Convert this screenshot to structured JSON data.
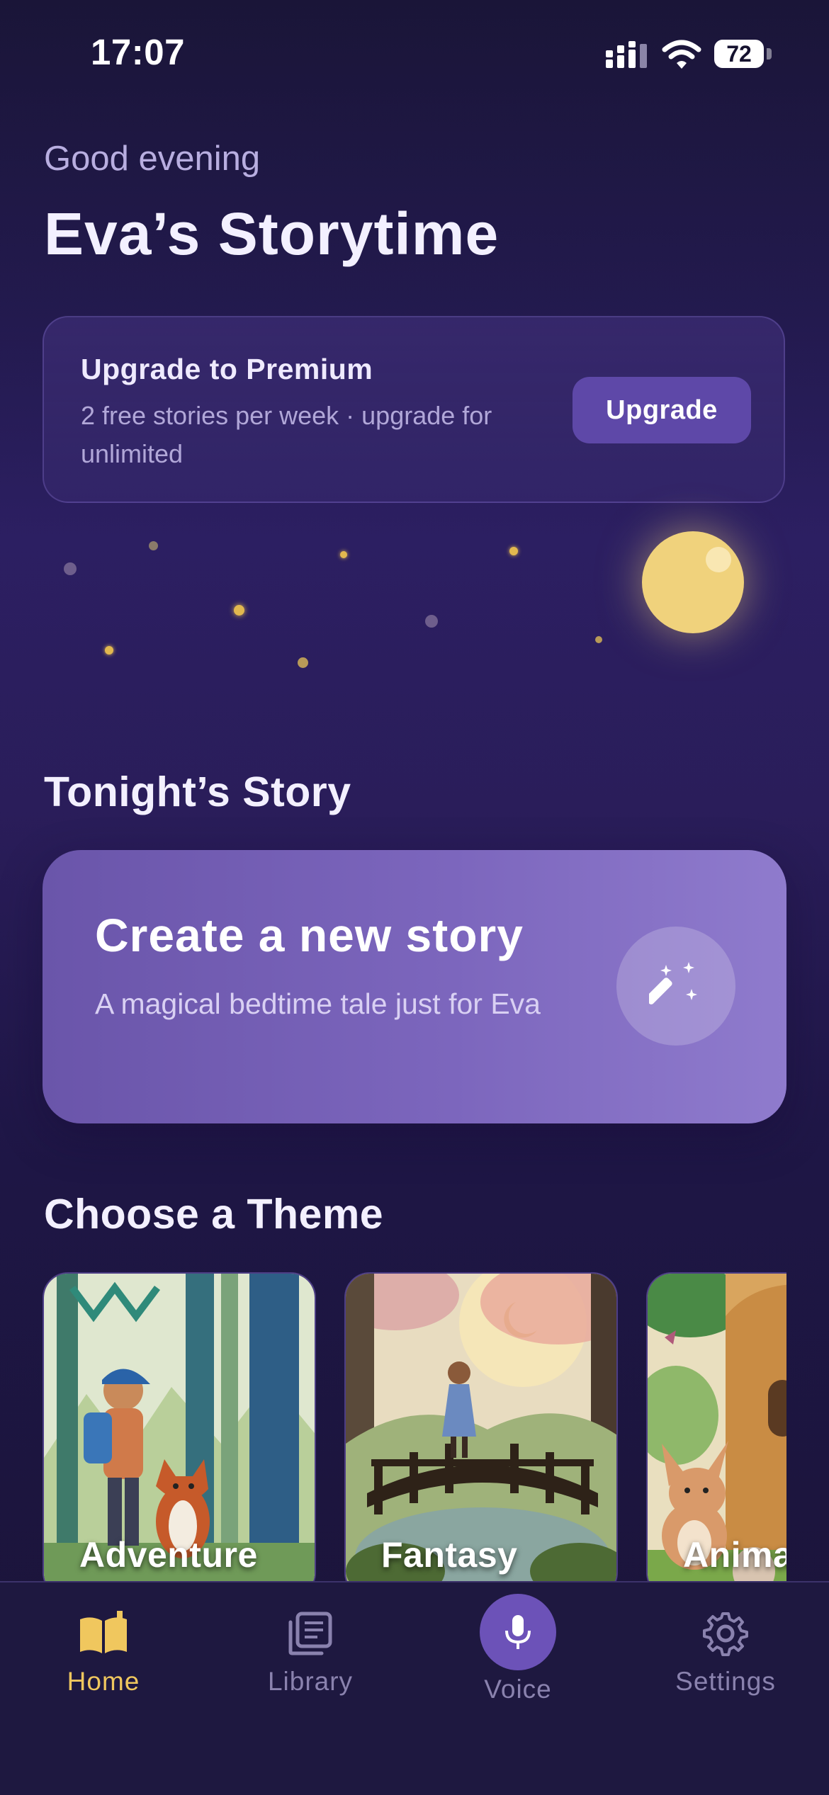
{
  "status": {
    "time": "17:07",
    "battery": "72"
  },
  "header": {
    "greeting": "Good evening",
    "title": "Eva’s Storytime"
  },
  "premium": {
    "title": "Upgrade to Premium",
    "text": "2 free stories per week · upgrade for unlimited",
    "button": "Upgrade"
  },
  "tonight": {
    "section_title": "Tonight’s Story",
    "card_title": "Create a new story",
    "card_subtitle": "A magical bedtime tale just for Eva",
    "icon": "magic-wand-icon"
  },
  "themes": {
    "section_title": "Choose a Theme",
    "items": [
      {
        "label": "Adventure"
      },
      {
        "label": "Fantasy"
      },
      {
        "label": "Animals"
      }
    ]
  },
  "tabbar": {
    "items": [
      {
        "label": "Home",
        "icon": "open-book-icon",
        "active": true
      },
      {
        "label": "Library",
        "icon": "stacked-pages-icon",
        "active": false
      },
      {
        "label": "Voice",
        "icon": "microphone-icon",
        "active": false
      },
      {
        "label": "Settings",
        "icon": "gear-icon",
        "active": false
      }
    ]
  },
  "colors": {
    "accent": "#f0c75e",
    "card": "#7c66bd",
    "background": "#231a4f",
    "moon": "#f0d27c"
  }
}
